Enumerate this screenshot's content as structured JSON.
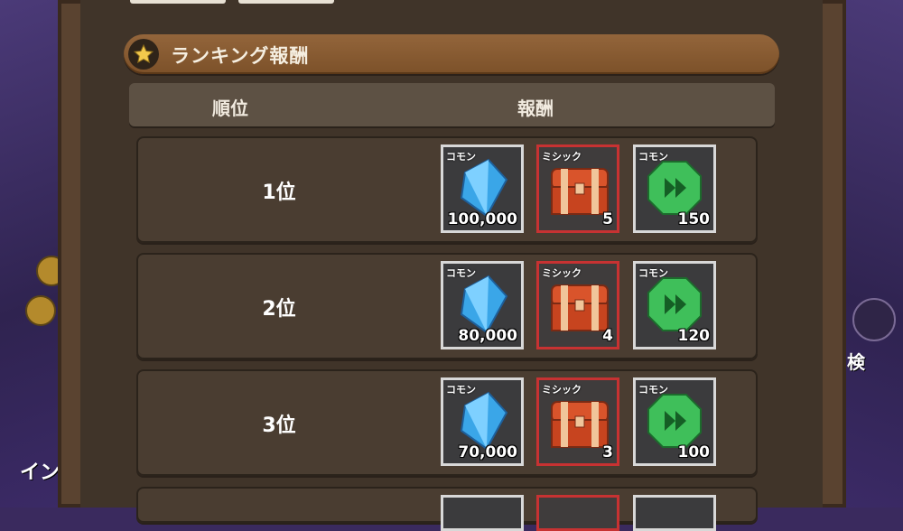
{
  "section": {
    "title": "ランキング報酬",
    "icon": "star-icon"
  },
  "table": {
    "headers": {
      "rank": "順位",
      "reward": "報酬"
    },
    "rows": [
      {
        "rank": "1位",
        "rewards": [
          {
            "rarity": "コモン",
            "item": "crystal-icon",
            "qty": "100,000"
          },
          {
            "rarity": "ミシック",
            "item": "chest-icon",
            "qty": "5"
          },
          {
            "rarity": "コモン",
            "item": "emerald-icon",
            "qty": "150"
          }
        ]
      },
      {
        "rank": "2位",
        "rewards": [
          {
            "rarity": "コモン",
            "item": "crystal-icon",
            "qty": "80,000"
          },
          {
            "rarity": "ミシック",
            "item": "chest-icon",
            "qty": "4"
          },
          {
            "rarity": "コモン",
            "item": "emerald-icon",
            "qty": "120"
          }
        ]
      },
      {
        "rank": "3位",
        "rewards": [
          {
            "rarity": "コモン",
            "item": "crystal-icon",
            "qty": "70,000"
          },
          {
            "rarity": "ミシック",
            "item": "chest-icon",
            "qty": "3"
          },
          {
            "rarity": "コモン",
            "item": "emerald-icon",
            "qty": "100"
          }
        ]
      }
    ]
  },
  "background": {
    "left_label": "イン",
    "right_labels": [
      "検"
    ]
  },
  "colors": {
    "mythic_border": "#c73232",
    "common_border": "#d8d8d8",
    "header_bar": "#8a5c33"
  }
}
